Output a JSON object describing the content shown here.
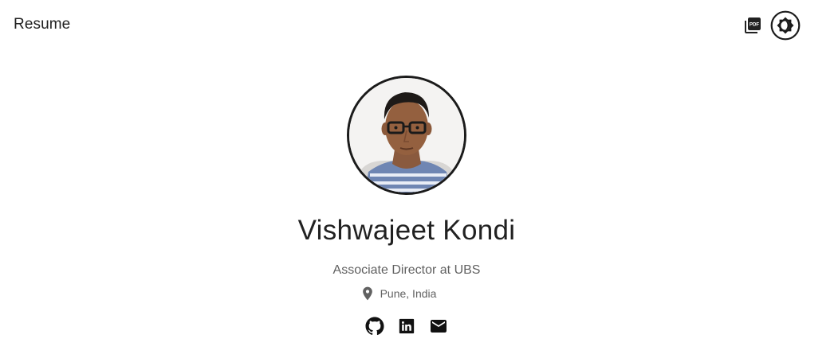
{
  "header": {
    "title": "Resume",
    "pdf_icon": "picture-as-pdf-icon",
    "theme_icon": "brightness-toggle-icon"
  },
  "profile": {
    "name": "Vishwajeet Kondi",
    "job_title": "Associate Director at UBS",
    "location": "Pune, India",
    "avatar_alt": "Vishwajeet Kondi"
  },
  "socials": [
    {
      "icon": "github-icon"
    },
    {
      "icon": "linkedin-icon"
    },
    {
      "icon": "email-icon"
    }
  ],
  "colors": {
    "text_primary": "#212121",
    "text_secondary": "#616161",
    "avatar_border": "#1b1b1b",
    "background": "#ffffff"
  }
}
